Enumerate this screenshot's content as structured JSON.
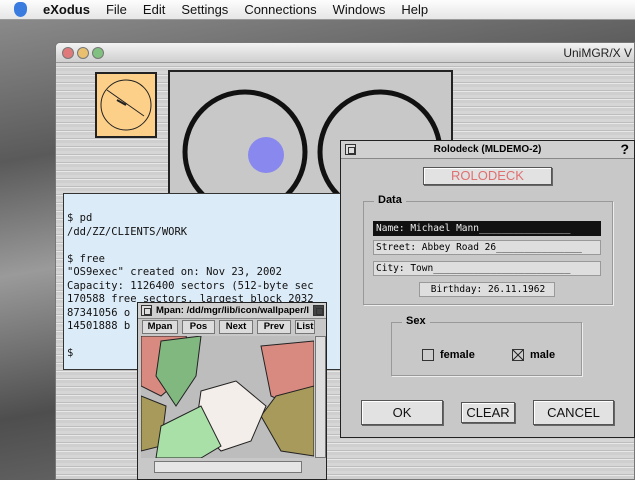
{
  "menubar": {
    "app": "eXodus",
    "items": [
      "File",
      "Edit",
      "Settings",
      "Connections",
      "Windows",
      "Help"
    ]
  },
  "window": {
    "title": "UniMGR/X V"
  },
  "terminal": {
    "lines": [
      "$ pd",
      "/dd/ZZ/CLIENTS/WORK",
      "",
      "$ free",
      "\"OS9exec\" created on: Nov 23, 2002",
      "Capacity: 1126400 sectors (512-byte sec",
      "170588 free sectors, largest block 2032",
      "87341056 o",
      "14501888 b",
      "",
      "$"
    ]
  },
  "mpan": {
    "title": "Mpan: /dd/mgr/lib/icon/wallpaper/l",
    "buttons": [
      "Mpan",
      "Pos",
      "Next",
      "Prev",
      "List"
    ]
  },
  "rolodeck": {
    "title": "Rolodeck (MLDEMO-2)",
    "help": "?",
    "banner": "ROLODECK",
    "data_legend": "Data",
    "name": "Name:   Michael Mann________________",
    "street": "Street: Abbey Road 26_______________",
    "city": "City:   Town________________________",
    "birthday": "Birthday: 26.11.1962",
    "sex_legend": "Sex",
    "female": "female",
    "male": "male",
    "female_checked": false,
    "male_checked": true,
    "ok": "OK",
    "clear": "CLEAR",
    "cancel": "CANCEL"
  },
  "colors": {
    "clock": "#fdd08a",
    "pupil": "#8888ee",
    "terminal_bg": "#dcebf8",
    "banner_text": "#e07070"
  }
}
